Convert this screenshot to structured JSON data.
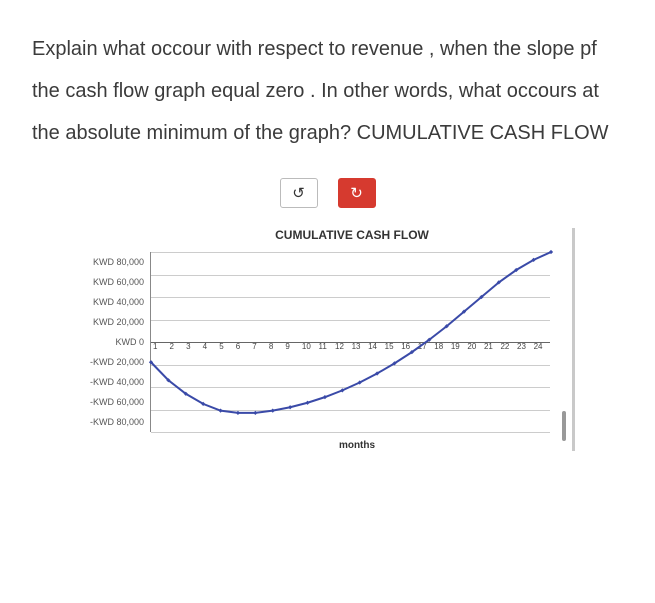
{
  "question_text": "Explain what occour with respect to revenue , when the slope pf the cash flow graph equal zero . In other words, what occours at the absolute minimum of the graph? CUMULATIVE CASH FLOW",
  "buttons": {
    "undo_glyph": "↺",
    "redo_glyph": "↻"
  },
  "chart_data": {
    "type": "line",
    "title": "CUMULATIVE CASH FLOW",
    "xlabel": "months",
    "ylabel": "",
    "y_ticks": [
      "KWD 80,000",
      "KWD 60,000",
      "KWD 40,000",
      "KWD 20,000",
      "KWD 0",
      "-KWD 20,000",
      "-KWD 40,000",
      "-KWD 60,000",
      "-KWD 80,000"
    ],
    "categories": [
      "1",
      "2",
      "3",
      "4",
      "5",
      "6",
      "7",
      "8",
      "9",
      "10",
      "11",
      "12",
      "13",
      "14",
      "15",
      "16",
      "17",
      "18",
      "19",
      "20",
      "21",
      "22",
      "23",
      "24"
    ],
    "series": [
      {
        "name": "Cumulative Cash Flow",
        "values": [
          -18000,
          -34000,
          -46000,
          -55000,
          -61000,
          -63000,
          -63000,
          -61000,
          -58000,
          -54000,
          -49000,
          -43000,
          -36000,
          -28000,
          -19000,
          -9000,
          2000,
          14000,
          27000,
          40000,
          53000,
          64000,
          73000,
          80000
        ]
      }
    ],
    "ylim": [
      -80000,
      80000
    ]
  }
}
